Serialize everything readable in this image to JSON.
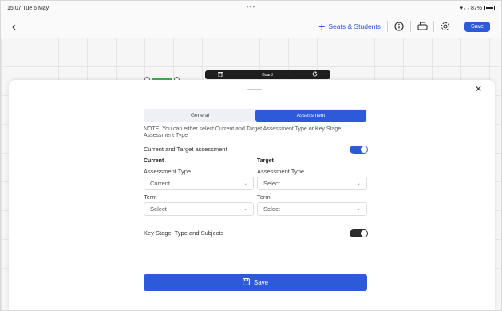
{
  "statusbar": {
    "time": "15:07",
    "date": "Tue 6 May",
    "signal": "▾ ◡ 87%"
  },
  "toolbar": {
    "seats_label": "Seats & Students",
    "save_label": "Save"
  },
  "canvas": {
    "board_label": "Board"
  },
  "modal": {
    "tabs": [
      {
        "label": "General",
        "active": false
      },
      {
        "label": "Assessment",
        "active": true
      }
    ],
    "note": "NOTE: You can either select Current and Target Assessment Type or Key Stage Assessment Type",
    "current_target_label": "Current and Target assessment",
    "current_target_enabled": true,
    "current": {
      "heading": "Current",
      "assessment_type_label": "Assessment Type",
      "assessment_type_value": "Current",
      "term_label": "Term",
      "term_value": "Select"
    },
    "target": {
      "heading": "Target",
      "assessment_type_label": "Assessment Type",
      "assessment_type_value": "Select",
      "term_label": "Term",
      "term_value": "Select"
    },
    "key_stage_label": "Key Stage, Type and Subjects",
    "key_stage_enabled": false,
    "save_label": "Save"
  },
  "colors": {
    "accent": "#2d5ad8",
    "toggle_off": "#2b2b2b"
  },
  "icons": [
    "back-chevron-icon",
    "plus-icon",
    "info-icon",
    "printer-icon",
    "gear-icon",
    "trash-icon",
    "refresh-icon",
    "close-icon",
    "save-icon",
    "chevron-down-icon"
  ]
}
